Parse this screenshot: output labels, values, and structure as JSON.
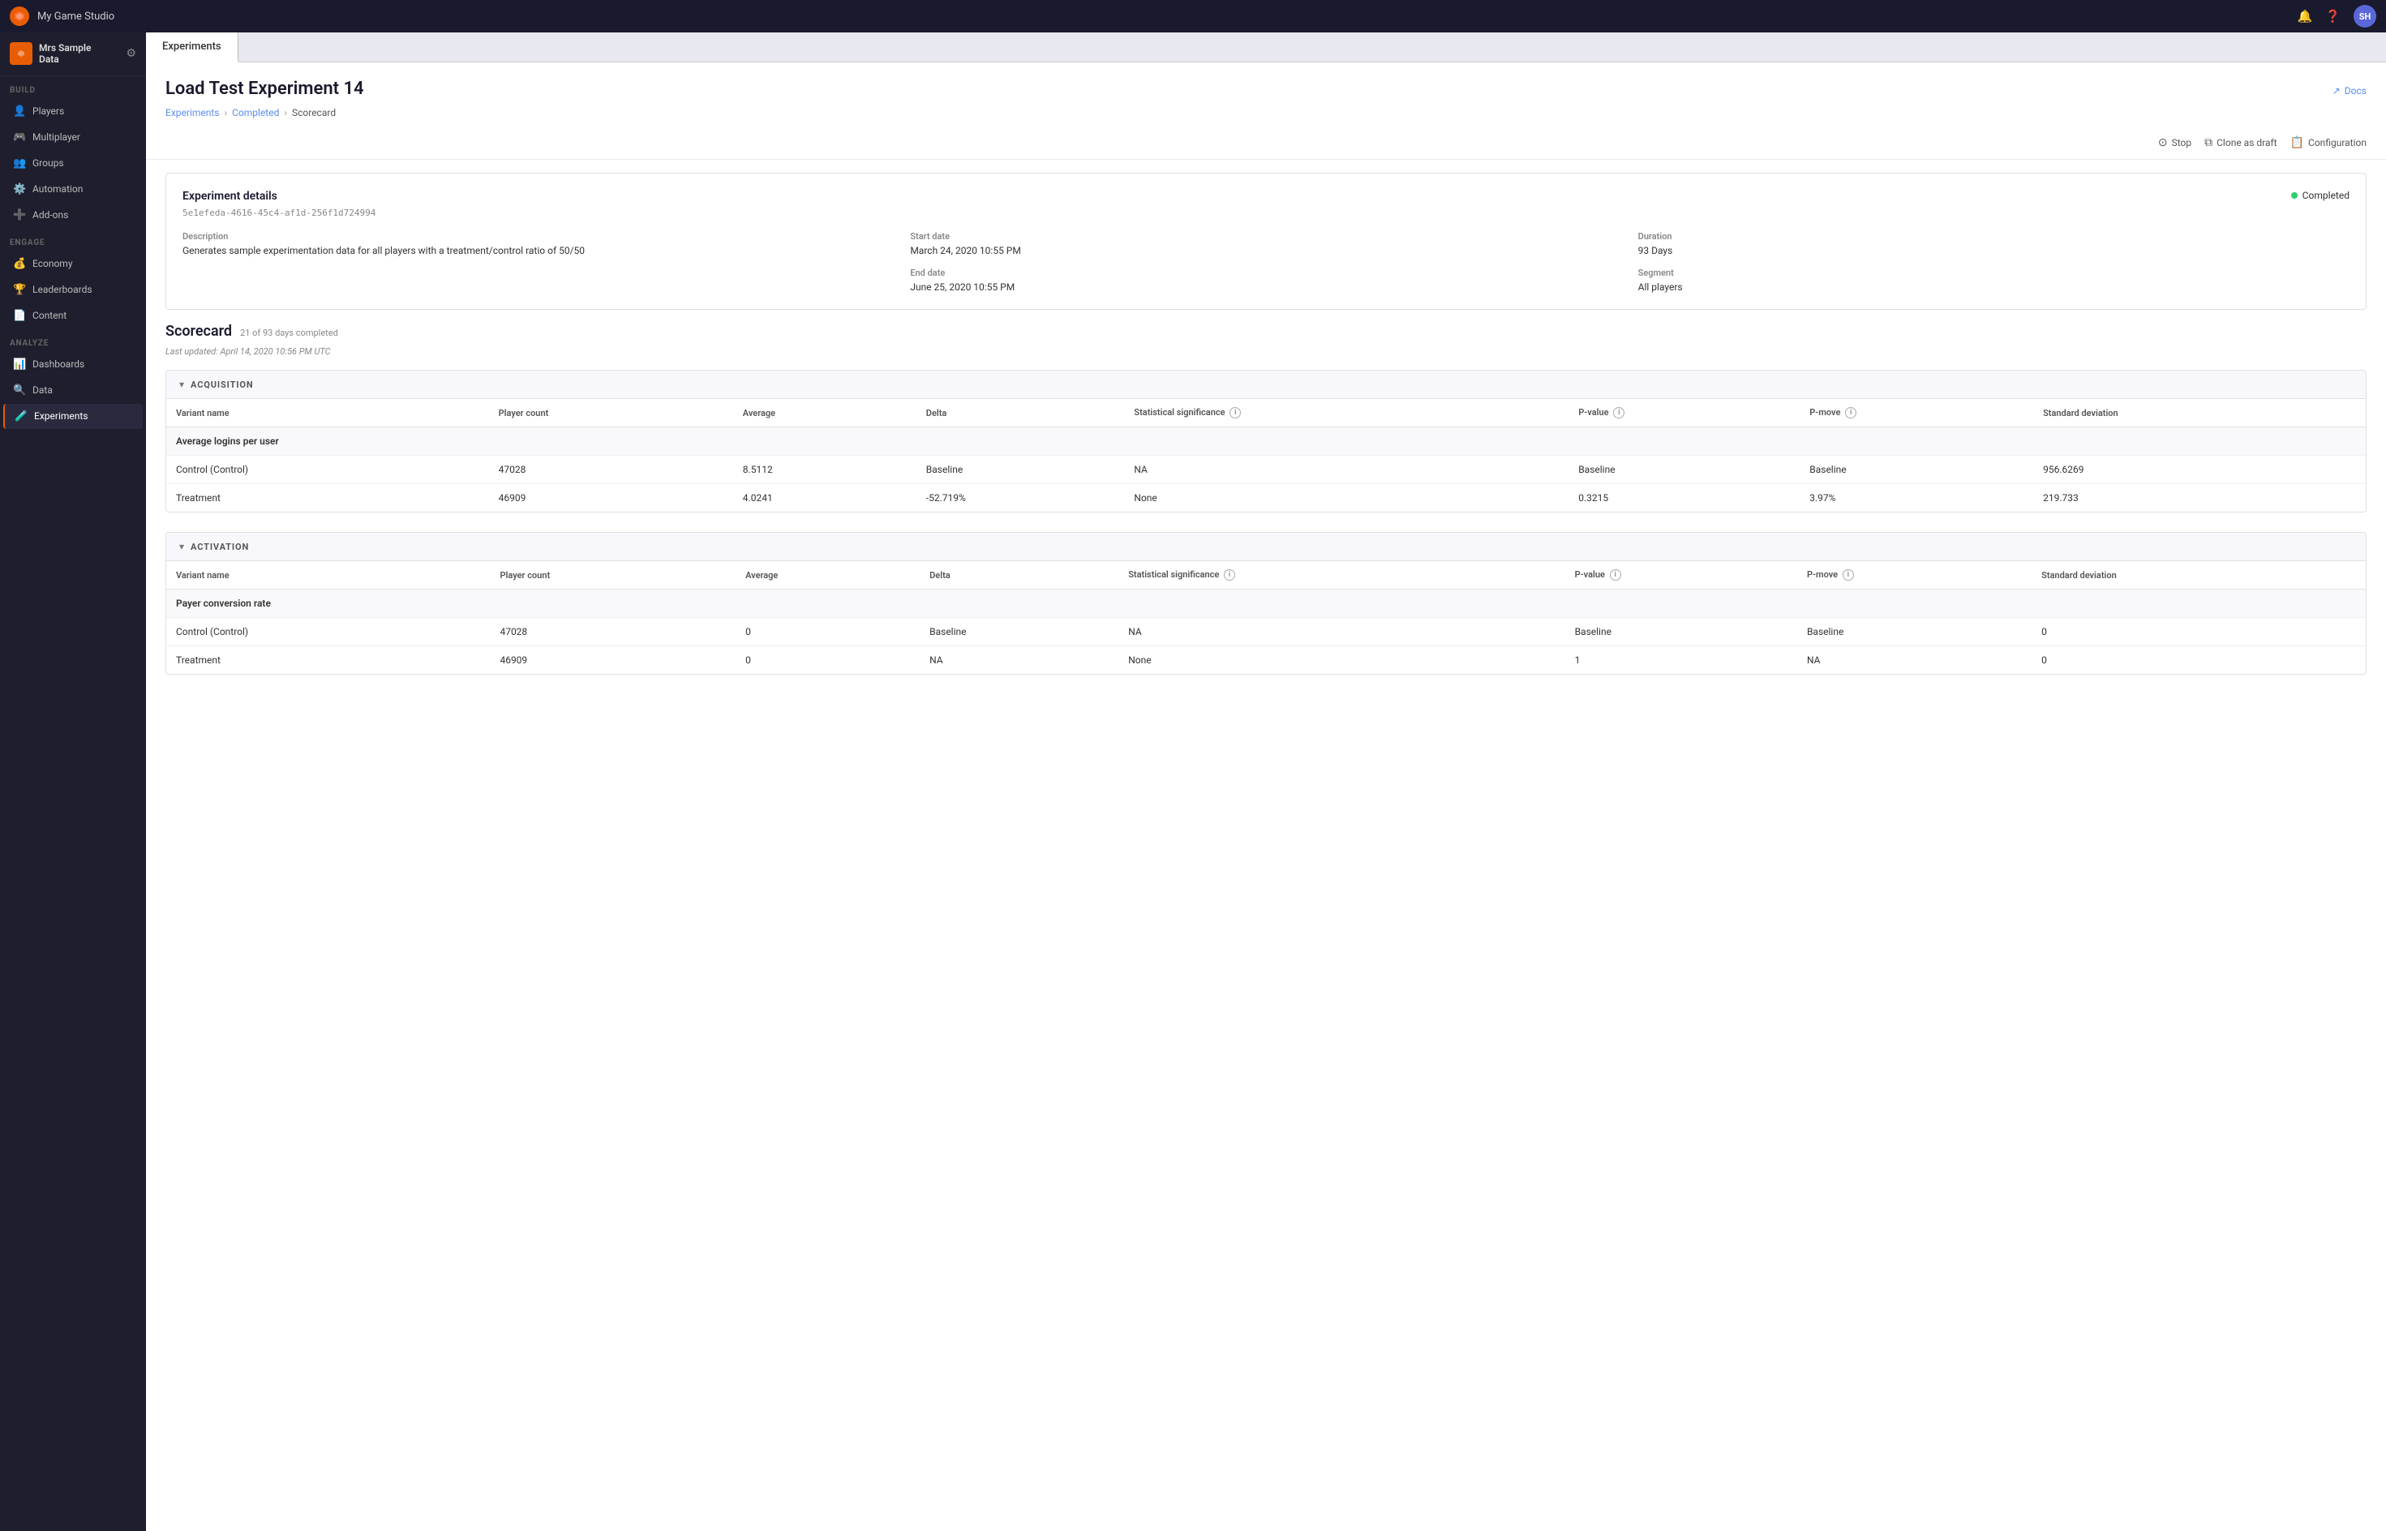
{
  "topbar": {
    "studio_name": "My Game Studio",
    "avatar_initials": "SH"
  },
  "sidebar": {
    "profile_name": "Mrs Sample\nData",
    "sections": [
      {
        "label": "BUILD",
        "items": [
          {
            "id": "players",
            "label": "Players",
            "icon": "👤"
          },
          {
            "id": "multiplayer",
            "label": "Multiplayer",
            "icon": "🎮"
          },
          {
            "id": "groups",
            "label": "Groups",
            "icon": "👥"
          },
          {
            "id": "automation",
            "label": "Automation",
            "icon": "⚙️"
          },
          {
            "id": "add-ons",
            "label": "Add-ons",
            "icon": "➕"
          }
        ]
      },
      {
        "label": "ENGAGE",
        "items": [
          {
            "id": "economy",
            "label": "Economy",
            "icon": "💰"
          },
          {
            "id": "leaderboards",
            "label": "Leaderboards",
            "icon": "🏆"
          },
          {
            "id": "content",
            "label": "Content",
            "icon": "📄"
          }
        ]
      },
      {
        "label": "ANALYZE",
        "items": [
          {
            "id": "dashboards",
            "label": "Dashboards",
            "icon": "📊"
          },
          {
            "id": "data",
            "label": "Data",
            "icon": "🔍"
          },
          {
            "id": "experiments",
            "label": "Experiments",
            "icon": "🧪",
            "active": true
          }
        ]
      }
    ]
  },
  "tabs": [
    {
      "label": "Experiments",
      "active": true
    }
  ],
  "page": {
    "title": "Load Test Experiment 14",
    "breadcrumb": {
      "items": [
        "Experiments",
        "Completed",
        "Scorecard"
      ]
    },
    "docs_label": "Docs"
  },
  "actions": {
    "stop_label": "Stop",
    "clone_label": "Clone as draft",
    "config_label": "Configuration"
  },
  "experiment_details": {
    "section_title": "Experiment details",
    "experiment_id": "5e1efeda-4616-45c4-af1d-256f1d724994",
    "status": "Completed",
    "description_label": "Description",
    "description_value": "Generates sample experimentation data for all players with a treatment/control ratio of 50/50",
    "start_date_label": "Start date",
    "start_date_value": "March 24, 2020 10:55 PM",
    "end_date_label": "End date",
    "end_date_value": "June 25, 2020 10:55 PM",
    "duration_label": "Duration",
    "duration_value": "93 Days",
    "segment_label": "Segment",
    "segment_value": "All players"
  },
  "scorecard": {
    "title": "Scorecard",
    "days_info": "21 of 93 days completed",
    "last_updated": "Last updated: April 14, 2020 10:56 PM UTC",
    "sections": [
      {
        "id": "acquisition",
        "title": "ACQUISITION",
        "collapsed": false,
        "metrics": [
          {
            "name": "Average logins per user",
            "columns": [
              "Variant name",
              "Player count",
              "Average",
              "Delta",
              "Statistical significance",
              "P-value",
              "P-move",
              "Standard deviation"
            ],
            "rows": [
              {
                "variant": "Control (Control)",
                "player_count": "47028",
                "average": "8.5112",
                "delta": "Baseline",
                "stat_sig": "NA",
                "p_value": "Baseline",
                "p_move": "Baseline",
                "std_dev": "956.6269"
              },
              {
                "variant": "Treatment",
                "player_count": "46909",
                "average": "4.0241",
                "delta": "-52.719%",
                "stat_sig": "None",
                "p_value": "0.3215",
                "p_move": "3.97%",
                "std_dev": "219.733"
              }
            ]
          }
        ]
      },
      {
        "id": "activation",
        "title": "ACTIVATION",
        "collapsed": false,
        "metrics": [
          {
            "name": "Payer conversion rate",
            "columns": [
              "Variant name",
              "Player count",
              "Average",
              "Delta",
              "Statistical significance",
              "P-value",
              "P-move",
              "Standard deviation"
            ],
            "rows": [
              {
                "variant": "Control (Control)",
                "player_count": "47028",
                "average": "0",
                "delta": "Baseline",
                "stat_sig": "NA",
                "p_value": "Baseline",
                "p_move": "Baseline",
                "std_dev": "0"
              },
              {
                "variant": "Treatment",
                "player_count": "46909",
                "average": "0",
                "delta": "NA",
                "stat_sig": "None",
                "p_value": "1",
                "p_move": "NA",
                "std_dev": "0"
              }
            ]
          }
        ]
      }
    ]
  }
}
